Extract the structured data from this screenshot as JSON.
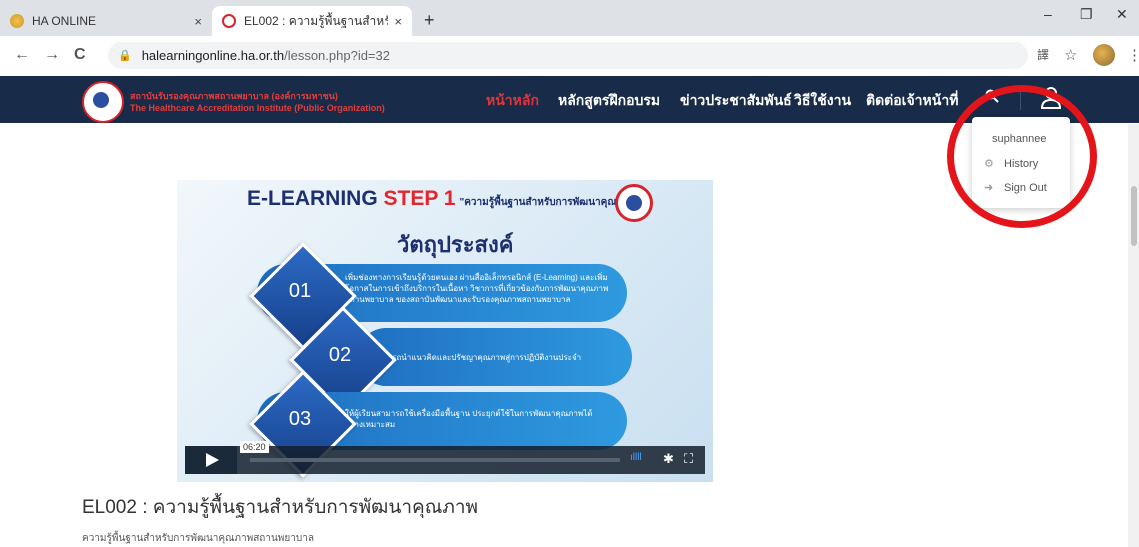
{
  "browser": {
    "tabs": [
      {
        "title": "HA ONLINE",
        "active": false
      },
      {
        "title": "EL002 : ความรู้พื้นฐานสำหรับการพัฒ",
        "active": true
      }
    ],
    "new_tab": "+",
    "close_glyph": "×",
    "window_controls": [
      "–",
      "❐",
      "✕"
    ],
    "url_host": "halearningonline.ha.or.th",
    "url_path": "/lesson.php?id=32",
    "nav_icons": [
      "←",
      "→",
      "C"
    ],
    "extension_icons": [
      "translate-icon",
      "star-icon",
      "more-icon"
    ]
  },
  "site": {
    "logo_line1": "สถาบันรับรองคุณภาพสถานพยาบาล (องค์การมหาชน)",
    "logo_line2": "The Healthcare Accreditation Institute (Public Organization)",
    "nav": [
      {
        "label": "หน้าหลัก",
        "active": true
      },
      {
        "label": "หลักสูตรฝึกอบรม",
        "active": false
      },
      {
        "label": "ข่าวประชาสัมพันธ์",
        "active": false
      },
      {
        "label": "วิธีใช้งาน",
        "active": false
      },
      {
        "label": "ติดต่อเจ้าหน้าที่",
        "active": false
      }
    ],
    "accent": "#e0343c",
    "header_bg": "#182b49"
  },
  "user_menu": {
    "username": "suphannee",
    "items": [
      {
        "label": "History",
        "icon": "gear-icon"
      },
      {
        "label": "Sign Out",
        "icon": "arrow-right-icon"
      }
    ]
  },
  "video": {
    "slide_title_prefix": "E-LEARNING",
    "slide_title_step": " STEP 1",
    "slide_subtitle": "\"ความรู้พื้นฐานสำหรับการพัฒนาคุณภาพ\"",
    "objective_heading": "วัตถุประสงค์",
    "items": [
      {
        "num": "01",
        "text": "เพิ่มช่องทางการเรียนรู้ด้วยตนเอง ผ่านสื่ออิเล็กทรอนิกส์ (E-Learning) และเพิ่มโอกาสในการเข้าถึงบริการในเนื้อหา วิชาการที่เกี่ยวข้องกับการพัฒนาคุณภาพสถานพยาบาล ของสถาบันพัฒนาและรับรองคุณภาพสถานพยาบาล"
      },
      {
        "num": "02",
        "text": "สามารถนำแนวคิดและปรัชญาคุณภาพสู่การปฏิบัติงานประจำ"
      },
      {
        "num": "03",
        "text": "ให้ผู้เรียนสามารถใช้เครื่องมือพื้นฐาน ประยุกต์ใช้ในการพัฒนาคุณภาพได้อย่างเหมาะสม"
      }
    ],
    "time": "06:20",
    "volume_glyph": "ıllll",
    "settings_glyph": "✱",
    "fullscreen_glyph": "⛶"
  },
  "lesson": {
    "title": "EL002 : ความรู้พื้นฐานสำหรับการพัฒนาคุณภาพ",
    "description": "ความรู้พื้นฐานสำหรับการพัฒนาคุณภาพสถานพยาบาล"
  }
}
